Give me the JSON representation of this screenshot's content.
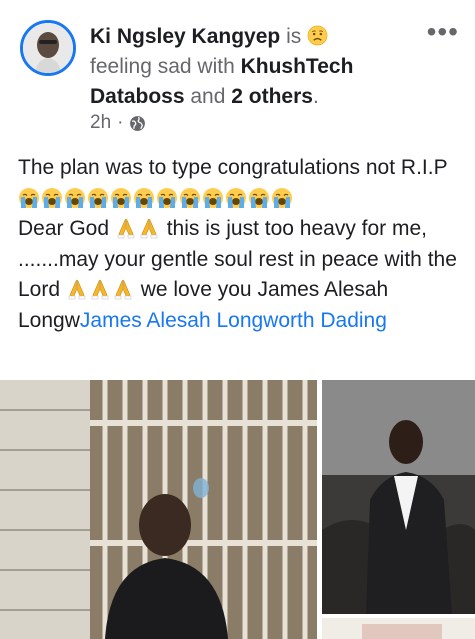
{
  "post": {
    "author": "Ki Ngsley Kangyep",
    "is_text": "is",
    "feeling_text": "feeling sad with",
    "tagged_user": "KhushTech Databoss",
    "and_text": "and",
    "others": "2 others",
    "period": ".",
    "time": "2h",
    "dot": "·",
    "privacy_icon": "globe-icon",
    "more_icon": "more-options-icon",
    "more_glyph": "•••",
    "feeling_emoji": "sad-face-emoji"
  },
  "body": {
    "line1": "The plan was to type congratulations not",
    "rip": "R.I.P",
    "crying_emoji_count_label": "loudly-crying-face-emoji",
    "dear_god": "Dear God ",
    "heavy_text": " this is just too heavy for me, .......may your gentle soul rest in peace with the Lord ",
    "love_text": " we love you James Alesah Longw",
    "mention": "James Alesah Longworth Dading",
    "prayer_emoji": "folded-hands-emoji"
  },
  "colors": {
    "link": "#1877f2",
    "meta": "#65676b",
    "text": "#1c1e21"
  }
}
